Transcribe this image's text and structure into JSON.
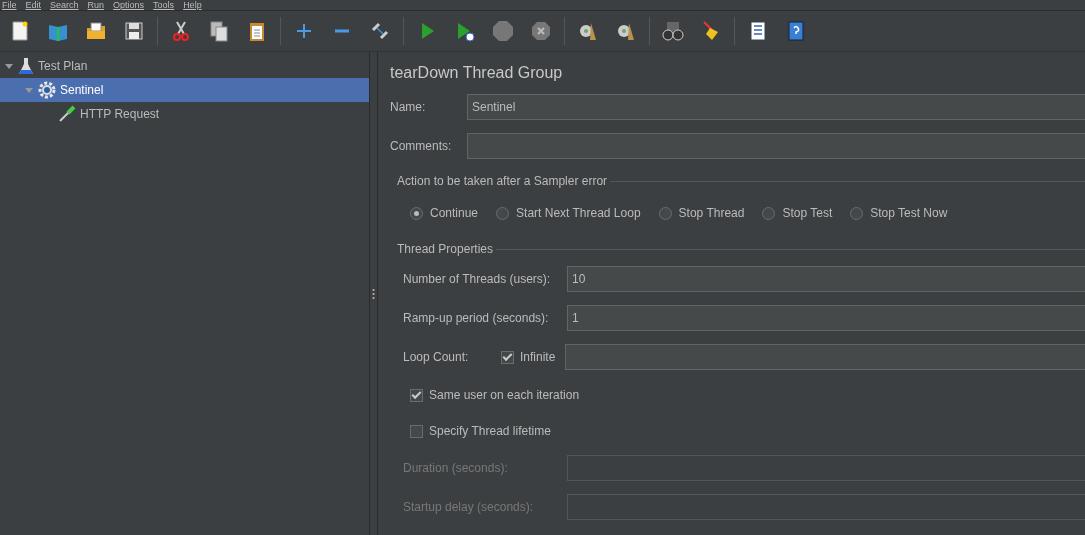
{
  "menu": [
    {
      "label": "File"
    },
    {
      "label": "Edit"
    },
    {
      "label": "Search"
    },
    {
      "label": "Run"
    },
    {
      "label": "Options"
    },
    {
      "label": "Tools"
    },
    {
      "label": "Help"
    }
  ],
  "tree": [
    {
      "label": "Test Plan",
      "kind": "plan",
      "expanded": true,
      "selected": false,
      "children": [
        {
          "label": "Sentinel",
          "kind": "thread_group",
          "expanded": true,
          "selected": true,
          "children": [
            {
              "label": "HTTP Request",
              "kind": "sampler",
              "selected": false
            }
          ]
        }
      ]
    }
  ],
  "panel": {
    "title": "tearDown Thread Group",
    "name": {
      "label": "Name:",
      "value": "Sentinel"
    },
    "comments": {
      "label": "Comments:"
    },
    "error_action": {
      "legend": "Action to be taken after a Sampler error",
      "options": [
        {
          "label": "Continue",
          "selected": true
        },
        {
          "label": "Start Next Thread Loop",
          "selected": false
        },
        {
          "label": "Stop Thread",
          "selected": false
        },
        {
          "label": "Stop Test",
          "selected": false
        },
        {
          "label": "Stop Test Now",
          "selected": false
        }
      ]
    },
    "thread_properties": {
      "legend": "Thread Properties",
      "threads": {
        "label": "Number of Threads (users):",
        "value": "10"
      },
      "rampup": {
        "label": "Ramp-up period (seconds):",
        "value": "1"
      },
      "loop": {
        "label": "Loop Count:",
        "infinite": {
          "label": "Infinite",
          "checked": true
        }
      },
      "same_user": {
        "label": "Same user on each iteration",
        "checked": true
      },
      "lifetime": {
        "label": "Specify Thread lifetime",
        "checked": false
      },
      "duration": {
        "label": "Duration (seconds):",
        "disabled": true
      },
      "startup": {
        "label": "Startup delay (seconds):",
        "disabled": true
      }
    }
  }
}
